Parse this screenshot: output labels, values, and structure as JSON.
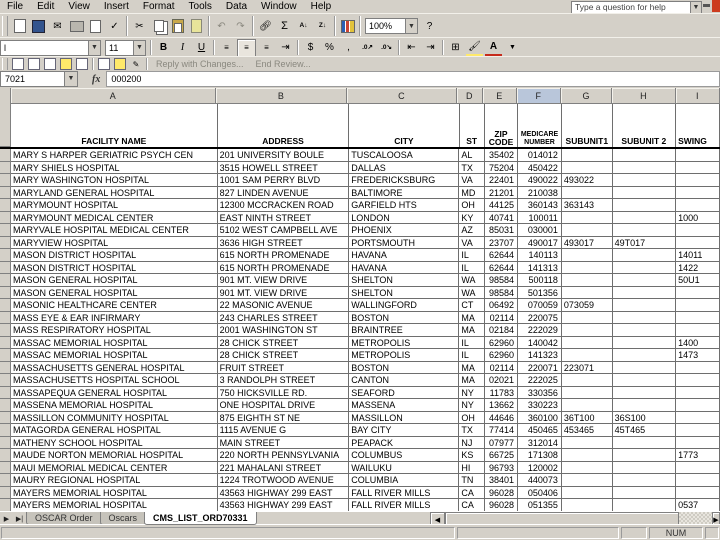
{
  "menu": {
    "items": [
      "File",
      "Edit",
      "View",
      "Insert",
      "Format",
      "Tools",
      "Data",
      "Window",
      "Help"
    ],
    "help_placeholder": "Type a question for help"
  },
  "toolbar": {
    "font_name_visible": "l",
    "font_size": "11",
    "zoom_value": "100%",
    "bold_label": "B",
    "italic_label": "I",
    "underline_label": "U",
    "autosum_label": "Σ",
    "sort_asc_label": "A↓",
    "sort_desc_label": "Z↓",
    "help_label": "?",
    "review_buttons": [
      "Reply with Changes...",
      "End Review..."
    ]
  },
  "formula_bar": {
    "name_box": "7021",
    "fx_label": "fx",
    "content": "000200"
  },
  "grid": {
    "column_letters": [
      "A",
      "B",
      "C",
      "D",
      "E",
      "F",
      "G",
      "H",
      "I"
    ],
    "selected_column": "F",
    "headers": [
      "FACILITY NAME",
      "ADDRESS",
      "CITY",
      "ST",
      "ZIP CODE",
      "MEDICARE NUMBER",
      "SUBUNIT1",
      "SUBUNIT 2",
      "SWING"
    ],
    "rows": [
      {
        "name": "MARY S HARPER GERIATRIC PSYCH CEN",
        "address": "201 UNIVERSITY BOULE",
        "city": "TUSCALOOSA",
        "st": "AL",
        "zip": "35402",
        "medicare": "014012",
        "sub1": "",
        "sub2": "",
        "swing": ""
      },
      {
        "name": "MARY SHIELS HOSPITAL",
        "address": "3515 HOWELL STREET",
        "city": "DALLAS",
        "st": "TX",
        "zip": "75204",
        "medicare": "450422",
        "sub1": "",
        "sub2": "",
        "swing": ""
      },
      {
        "name": "MARY WASHINGTON HOSPITAL",
        "address": "1001 SAM PERRY BLVD",
        "city": "FREDERICKSBURG",
        "st": "VA",
        "zip": "22401",
        "medicare": "490022",
        "sub1": "493022",
        "sub2": "",
        "swing": ""
      },
      {
        "name": "MARYLAND GENERAL HOSPITAL",
        "address": "827 LINDEN AVENUE",
        "city": "BALTIMORE",
        "st": "MD",
        "zip": "21201",
        "medicare": "210038",
        "sub1": "",
        "sub2": "",
        "swing": ""
      },
      {
        "name": "MARYMOUNT HOSPITAL",
        "address": "12300 MCCRACKEN ROAD",
        "city": "GARFIELD HTS",
        "st": "OH",
        "zip": "44125",
        "medicare": "360143",
        "sub1": "363143",
        "sub2": "",
        "swing": ""
      },
      {
        "name": "MARYMOUNT MEDICAL CENTER",
        "address": "EAST NINTH STREET",
        "city": "LONDON",
        "st": "KY",
        "zip": "40741",
        "medicare": "100011",
        "sub1": "",
        "sub2": "",
        "swing": "1000"
      },
      {
        "name": "MARYVALE HOSPITAL MEDICAL CENTER",
        "address": "5102 WEST CAMPBELL AVE",
        "city": "PHOENIX",
        "st": "AZ",
        "zip": "85031",
        "medicare": "030001",
        "sub1": "",
        "sub2": "",
        "swing": ""
      },
      {
        "name": "MARYVIEW HOSPITAL",
        "address": "3636 HIGH STREET",
        "city": "PORTSMOUTH",
        "st": "VA",
        "zip": "23707",
        "medicare": "490017",
        "sub1": "493017",
        "sub2": "49T017",
        "swing": ""
      },
      {
        "name": "MASON DISTRICT HOSPITAL",
        "address": "615 NORTH PROMENADE",
        "city": "HAVANA",
        "st": "IL",
        "zip": "62644",
        "medicare": "140113",
        "sub1": "",
        "sub2": "",
        "swing": "14011"
      },
      {
        "name": "MASON DISTRICT HOSPITAL",
        "address": "615 NORTH PROMENADE",
        "city": "HAVANA",
        "st": "IL",
        "zip": "62644",
        "medicare": "141313",
        "sub1": "",
        "sub2": "",
        "swing": "1422"
      },
      {
        "name": "MASON GENERAL HOSPITAL",
        "address": "901 MT. VIEW DRIVE",
        "city": "SHELTON",
        "st": "WA",
        "zip": "98584",
        "medicare": "500118",
        "sub1": "",
        "sub2": "",
        "swing": "50U1"
      },
      {
        "name": "MASON GENERAL HOSPITAL",
        "address": "901 MT. VIEW DRIVE",
        "city": "SHELTON",
        "st": "WA",
        "zip": "98584",
        "medicare": "501356",
        "sub1": "",
        "sub2": "",
        "swing": ""
      },
      {
        "name": "MASONIC HEALTHCARE CENTER",
        "address": "22 MASONIC AVENUE",
        "city": "WALLINGFORD",
        "st": "CT",
        "zip": "06492",
        "medicare": "070059",
        "sub1": "073059",
        "sub2": "",
        "swing": ""
      },
      {
        "name": "MASS EYE & EAR INFIRMARY",
        "address": "243 CHARLES STREET",
        "city": "BOSTON",
        "st": "MA",
        "zip": "02114",
        "medicare": "220075",
        "sub1": "",
        "sub2": "",
        "swing": ""
      },
      {
        "name": "MASS RESPIRATORY HOSPITAL",
        "address": "2001 WASHINGTON ST",
        "city": "BRAINTREE",
        "st": "MA",
        "zip": "02184",
        "medicare": "222029",
        "sub1": "",
        "sub2": "",
        "swing": ""
      },
      {
        "name": "MASSAC MEMORIAL HOSPITAL",
        "address": "28 CHICK STREET",
        "city": "METROPOLIS",
        "st": "IL",
        "zip": "62960",
        "medicare": "140042",
        "sub1": "",
        "sub2": "",
        "swing": "1400"
      },
      {
        "name": "MASSAC MEMORIAL HOSPITAL",
        "address": "28 CHICK STREET",
        "city": "METROPOLIS",
        "st": "IL",
        "zip": "62960",
        "medicare": "141323",
        "sub1": "",
        "sub2": "",
        "swing": "1473"
      },
      {
        "name": "MASSACHUSETTS GENERAL HOSPITAL",
        "address": "FRUIT STREET",
        "city": "BOSTON",
        "st": "MA",
        "zip": "02114",
        "medicare": "220071",
        "sub1": "223071",
        "sub2": "",
        "swing": ""
      },
      {
        "name": "MASSACHUSETTS HOSPITAL SCHOOL",
        "address": "3 RANDOLPH STREET",
        "city": "CANTON",
        "st": "MA",
        "zip": "02021",
        "medicare": "222025",
        "sub1": "",
        "sub2": "",
        "swing": ""
      },
      {
        "name": "MASSAPEQUA GENERAL HOSPITAL",
        "address": "750 HICKSVILLE RD.",
        "city": "SEAFORD",
        "st": "NY",
        "zip": "11783",
        "medicare": "330356",
        "sub1": "",
        "sub2": "",
        "swing": ""
      },
      {
        "name": "MASSENA MEMORIAL HOSPITAL",
        "address": "ONE HOSPITAL DRIVE",
        "city": "MASSENA",
        "st": "NY",
        "zip": "13662",
        "medicare": "330223",
        "sub1": "",
        "sub2": "",
        "swing": ""
      },
      {
        "name": "MASSILLON COMMUNITY HOSPITAL",
        "address": "875 EIGHTH ST NE",
        "city": "MASSILLON",
        "st": "OH",
        "zip": "44646",
        "medicare": "360100",
        "sub1": "36T100",
        "sub2": "36S100",
        "swing": ""
      },
      {
        "name": "MATAGORDA GENERAL HOSPITAL",
        "address": "1115 AVENUE G",
        "city": "BAY CITY",
        "st": "TX",
        "zip": "77414",
        "medicare": "450465",
        "sub1": "453465",
        "sub2": "45T465",
        "swing": ""
      },
      {
        "name": "MATHENY SCHOOL HOSPITAL",
        "address": "MAIN STREET",
        "city": "PEAPACK",
        "st": "NJ",
        "zip": "07977",
        "medicare": "312014",
        "sub1": "",
        "sub2": "",
        "swing": ""
      },
      {
        "name": "MAUDE NORTON MEMORIAL HOSPITAL",
        "address": "220 NORTH PENNSYLVANIA",
        "city": "COLUMBUS",
        "st": "KS",
        "zip": "66725",
        "medicare": "171308",
        "sub1": "",
        "sub2": "",
        "swing": "1773"
      },
      {
        "name": "MAUI MEMORIAL MEDICAL CENTER",
        "address": "221 MAHALANI STREET",
        "city": "WAILUKU",
        "st": "HI",
        "zip": "96793",
        "medicare": "120002",
        "sub1": "",
        "sub2": "",
        "swing": ""
      },
      {
        "name": "MAURY REGIONAL HOSPITAL",
        "address": "1224 TROTWOOD AVENUE",
        "city": "COLUMBIA",
        "st": "TN",
        "zip": "38401",
        "medicare": "440073",
        "sub1": "",
        "sub2": "",
        "swing": ""
      },
      {
        "name": "MAYERS MEMORIAL HOSPITAL",
        "address": "43563 HIGHWAY 299 EAST",
        "city": "FALL RIVER MILLS",
        "st": "CA",
        "zip": "96028",
        "medicare": "050406",
        "sub1": "",
        "sub2": "",
        "swing": ""
      },
      {
        "name": "MAYERS MEMORIAL HOSPITAL",
        "address": "43563 HIGHWAY 299 EAST",
        "city": "FALL RIVER MILLS",
        "st": "CA",
        "zip": "96028",
        "medicare": "051355",
        "sub1": "",
        "sub2": "",
        "swing": "0537"
      }
    ]
  },
  "sheet_tabs": {
    "tabs": [
      {
        "label": "OSCAR Order",
        "active": false
      },
      {
        "label": "Oscars",
        "active": false
      },
      {
        "label": "CMS_LIST_ORD70331",
        "active": true
      }
    ]
  },
  "status_bar": {
    "num": "NUM"
  },
  "colors": {
    "ui": "#d4d0c8",
    "selected_column_header": "#b9c6da",
    "close_button": "#cc3b1e",
    "grid_line": "#6e6e6e"
  }
}
